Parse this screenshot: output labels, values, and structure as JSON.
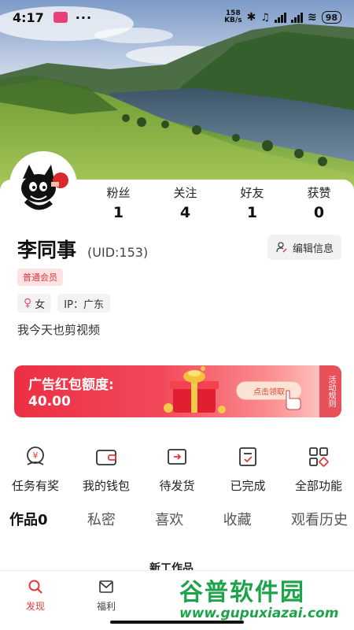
{
  "status_bar": {
    "time": "4:17",
    "dots": "···",
    "speed_value": "158",
    "speed_unit": "KB/s",
    "battery": "98"
  },
  "profile": {
    "stats": [
      {
        "label": "粉丝",
        "value": "1"
      },
      {
        "label": "关注",
        "value": "4"
      },
      {
        "label": "好友",
        "value": "1"
      },
      {
        "label": "获赞",
        "value": "0"
      }
    ],
    "name": "李同事",
    "uid": "(UID:153)",
    "edit_label": "编辑信息",
    "member_badge": "普通会员",
    "gender": "女",
    "ip": "IP：广东",
    "bio": "我今天也剪视频"
  },
  "banner": {
    "title": "广告红包额度:",
    "amount": "40.00",
    "cta": "点击领取",
    "side_line1": "活动",
    "side_line2": "规则"
  },
  "functions": [
    {
      "label": "任务有奖",
      "icon": "reward-icon"
    },
    {
      "label": "我的钱包",
      "icon": "wallet-icon"
    },
    {
      "label": "待发货",
      "icon": "shipping-icon"
    },
    {
      "label": "已完成",
      "icon": "completed-icon"
    },
    {
      "label": "全部功能",
      "icon": "grid-icon"
    }
  ],
  "content_tabs": [
    "作品0",
    "私密",
    "喜欢",
    "收藏",
    "观看历史"
  ],
  "partial_section": "新工作品",
  "bottom_nav": [
    {
      "label": "发现",
      "icon": "search-icon",
      "active": true
    },
    {
      "label": "福利",
      "icon": "mail-icon",
      "active": false
    }
  ],
  "watermark": {
    "title": "谷普软件园",
    "url": "www.gupuxiazai.com"
  },
  "colors": {
    "accent": "#e23a3a",
    "badge_bg": "#fde3e3",
    "watermark": "#1fa34a"
  }
}
